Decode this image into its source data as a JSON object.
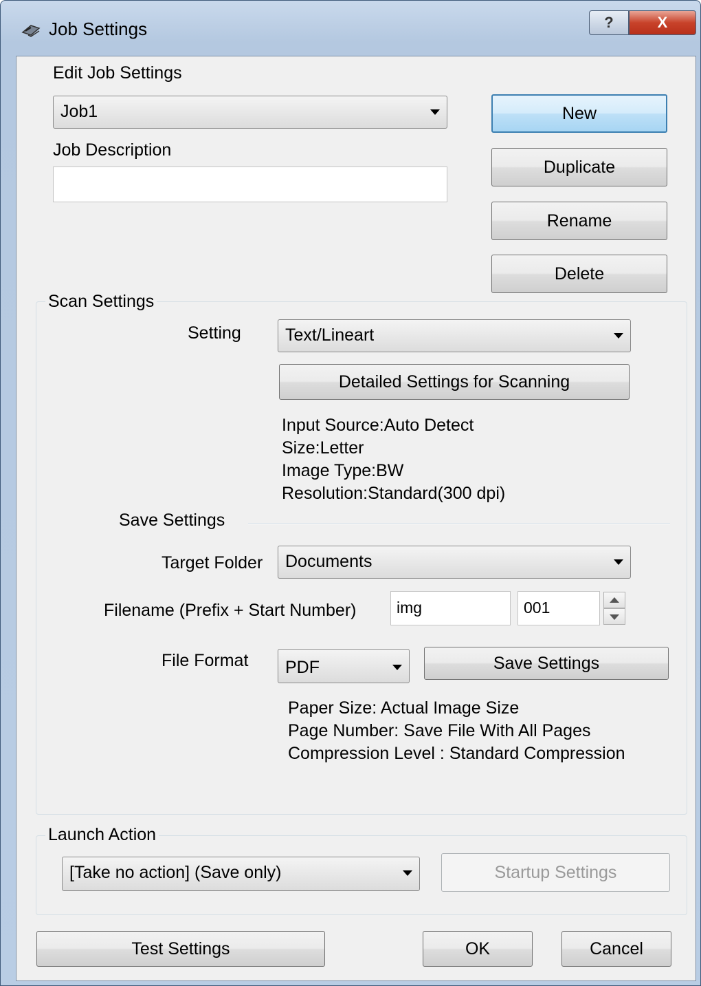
{
  "window": {
    "title": "Job Settings",
    "help_glyph": "?",
    "close_glyph": "X",
    "app_icon": "scanner-icon"
  },
  "job": {
    "edit_label": "Edit Job Settings",
    "selected_job": "Job1",
    "description_label": "Job Description",
    "description_value": "",
    "buttons": {
      "new": "New",
      "duplicate": "Duplicate",
      "rename": "Rename",
      "delete": "Delete"
    }
  },
  "scan": {
    "group_title": "Scan Settings",
    "setting_label": "Setting",
    "setting_value": "Text/Lineart",
    "detailed_button": "Detailed Settings for Scanning",
    "info": [
      "Input Source:Auto Detect",
      "Size:Letter",
      "Image Type:BW",
      "Resolution:Standard(300 dpi)"
    ]
  },
  "save": {
    "section_title": "Save Settings",
    "target_label": "Target Folder",
    "target_value": "Documents",
    "filename_label": "Filename (Prefix + Start Number)",
    "prefix_value": "img",
    "start_number_value": "001",
    "format_label": "File Format",
    "format_value": "PDF",
    "save_settings_button": "Save Settings",
    "info": [
      "Paper Size: Actual Image Size",
      "Page Number: Save File With All Pages",
      "Compression Level : Standard Compression"
    ]
  },
  "launch": {
    "group_title": "Launch Action",
    "action_value": "[Take no action] (Save only)",
    "startup_button": "Startup Settings"
  },
  "footer": {
    "test_button": "Test Settings",
    "ok_button": "OK",
    "cancel_button": "Cancel"
  }
}
